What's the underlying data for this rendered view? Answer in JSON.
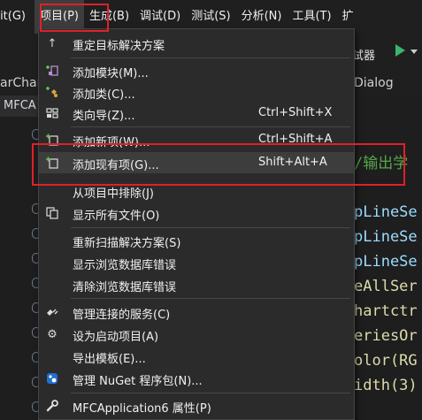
{
  "menubar": {
    "items": [
      {
        "label": "Git(G)"
      },
      {
        "label": "项目(P)"
      },
      {
        "label": "生成(B)"
      },
      {
        "label": "调试(D)"
      },
      {
        "label": "测试(S)"
      },
      {
        "label": "分析(N)"
      },
      {
        "label": "工具(T)"
      },
      {
        "label": "扩"
      }
    ]
  },
  "toolbar": {
    "label": "试器"
  },
  "tabs": {
    "left": "arChart",
    "right": "Dialog"
  },
  "doc_tab": {
    "label": "MFCA"
  },
  "code_lines": [
    "/输出学",
    "pLineSe",
    "pLineSe",
    "pLineSe",
    "eAllSer",
    "hartctr",
    "eriesOr",
    "olor(RG",
    "idth(3)"
  ],
  "menu": {
    "items": [
      {
        "label": "重定目标解决方案",
        "shortcut": "",
        "icon": "arrow-up-icon"
      },
      {
        "label": "添加模块(M)...",
        "shortcut": "",
        "icon": "add-module-icon"
      },
      {
        "label": "添加类(C)...",
        "shortcut": "",
        "icon": "add-class-icon"
      },
      {
        "label": "类向导(Z)...",
        "shortcut": "Ctrl+Shift+X",
        "icon": "class-wizard-icon"
      },
      {
        "label": "添加新项(W)...",
        "shortcut": "Ctrl+Shift+A",
        "icon": "add-new-item-icon"
      },
      {
        "label": "添加现有项(G)...",
        "shortcut": "Shift+Alt+A",
        "icon": "add-existing-item-icon"
      },
      {
        "label": "从项目中排除(J)",
        "shortcut": "",
        "icon": ""
      },
      {
        "label": "显示所有文件(O)",
        "shortcut": "",
        "icon": "show-all-files-icon"
      },
      {
        "label": "重新扫描解决方案(S)",
        "shortcut": "",
        "icon": ""
      },
      {
        "label": "显示浏览数据库错误",
        "shortcut": "",
        "icon": ""
      },
      {
        "label": "清除浏览数据库错误",
        "shortcut": "",
        "icon": ""
      },
      {
        "label": "管理连接的服务(C)",
        "shortcut": "",
        "icon": "connected-services-icon"
      },
      {
        "label": "设为启动项目(A)",
        "shortcut": "",
        "icon": "gear-icon"
      },
      {
        "label": "导出模板(E)...",
        "shortcut": "",
        "icon": ""
      },
      {
        "label": "管理 NuGet 程序包(N)...",
        "shortcut": "",
        "icon": "nuget-icon"
      },
      {
        "label": "MFCApplication6 属性(P)",
        "shortcut": "",
        "icon": "wrench-icon"
      }
    ]
  },
  "colors": {
    "highlight_box": "#e0202a",
    "menu_bg": "#2b2b2b",
    "accent_play": "#3cb371"
  }
}
